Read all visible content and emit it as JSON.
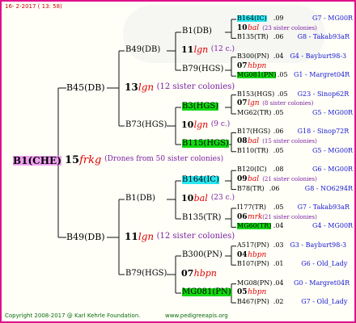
{
  "header": {
    "date_line": "16-  2-2017 ( 13: 58)"
  },
  "footer": {
    "copyright": "Copyright 2008-2017 @ Karl Kehrle Foundation.",
    "website": "www.pedigreeapis.org"
  },
  "colors": {
    "border": "#e0108c",
    "green_highlight": "#12d812",
    "cyan_highlight": "#28e6f0",
    "root_highlight": "#f0a0f0",
    "label_blue": "#1515d0",
    "label_purple": "#7a1fa0",
    "label_red": "#e00000"
  },
  "root": {
    "id": "B1(CHE)",
    "gen": "15",
    "name": "frkg",
    "note": "(Drones from 50 sister colonies)"
  },
  "g1": [
    {
      "id": "B45(DB)",
      "gen": "13",
      "name": "lgn",
      "note": "(12 sister colonies)"
    },
    {
      "id": "B49(DB)",
      "gen": "11",
      "name": "lgn",
      "note": "(12 sister colonies)"
    }
  ],
  "g2": [
    {
      "id": "B49(DB)",
      "gen": "11",
      "name": "lgn",
      "note": "(12 c.)"
    },
    {
      "id": "B73(HGS)",
      "gen": "10",
      "name": "lgn",
      "note": "(9 c.)"
    },
    {
      "id": "B1(DB)",
      "gen": "10",
      "name": "bal",
      "note": "(23 c.)"
    },
    {
      "id": "B79(HGS)",
      "gen": "07",
      "name": "hbpn",
      "note": ""
    }
  ],
  "g3": [
    {
      "id": "B1(DB)"
    },
    {
      "id": "B79(HGS)"
    },
    {
      "id": "B3(HGS)"
    },
    {
      "id": "B115(HGS)"
    },
    {
      "id": "B164(IC)"
    },
    {
      "id": "B135(TR)"
    },
    {
      "id": "B300(PN)"
    },
    {
      "id": "MG081(PN)"
    }
  ],
  "g4": [
    {
      "mid": {
        "gen": "10",
        "name": "bal",
        "note": "(23 sister colonies)"
      },
      "top": {
        "id": "B164(IC)",
        "num": ".09",
        "origin": "G7 - MG00R"
      },
      "bot": {
        "id": "B135(TR)",
        "num": ".06",
        "origin": "G8 - Takab93aR"
      }
    },
    {
      "mid": {
        "gen": "07",
        "name": "hbpn",
        "note": ""
      },
      "top": {
        "id": "B300(PN)",
        "num": ".04",
        "origin": "G4 - Bayburt98-3"
      },
      "bot": {
        "id": "MG081(PN)",
        "num": ".05",
        "origin": "G1 - Margret04R"
      }
    },
    {
      "mid": {
        "gen": "07",
        "name": "lgn",
        "note": "(8 sister colonies)"
      },
      "top": {
        "id": "B153(HGS)",
        "num": ".05",
        "origin": "G23 - Sinop62R"
      },
      "bot": {
        "id": "MG62(TR)",
        "num": ".05",
        "origin": "G5 - MG00R"
      }
    },
    {
      "mid": {
        "gen": "08",
        "name": "bal",
        "note": "(15 sister colonies)"
      },
      "top": {
        "id": "B17(HGS)",
        "num": ".06",
        "origin": "G18 - Sinop72R"
      },
      "bot": {
        "id": "B110(TR)",
        "num": ".05",
        "origin": "G5 - MG00R"
      }
    },
    {
      "mid": {
        "gen": "09",
        "name": "bal",
        "note": "(21 sister colonies)"
      },
      "top": {
        "id": "B120(IC)",
        "num": ".08",
        "origin": "G6 - MG00R"
      },
      "bot": {
        "id": "B78(TR)",
        "num": ".06",
        "origin": "G8 - NO6294R"
      }
    },
    {
      "mid": {
        "gen": "06",
        "name": "mrk",
        "note": "(21 sister colonies)"
      },
      "top": {
        "id": "I177(TR)",
        "num": ".05",
        "origin": "G7 - Takab93aR"
      },
      "bot": {
        "id": "MG60(TR)",
        "num": ".04",
        "origin": "G4 - MG00R"
      }
    },
    {
      "mid": {
        "gen": "04",
        "name": "hbpn",
        "note": ""
      },
      "top": {
        "id": "A517(PN)",
        "num": ".03",
        "origin": "G3 - Bayburt98-3"
      },
      "bot": {
        "id": "B107(PN)",
        "num": ".01",
        "origin": "G6 - Old_Lady"
      }
    },
    {
      "mid": {
        "gen": "05",
        "name": "hbpn",
        "note": ""
      },
      "top": {
        "id": "MG08(PN)",
        "num": ".04",
        "origin": "G0 - Margret04R"
      },
      "bot": {
        "id": "B467(PN)",
        "num": ".02",
        "origin": "G7 - Old_Lady"
      }
    }
  ]
}
